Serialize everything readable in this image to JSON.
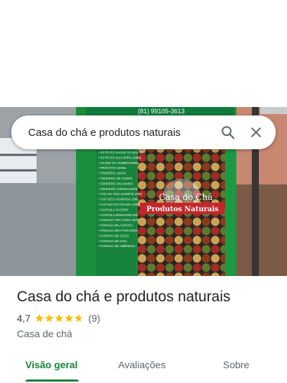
{
  "search": {
    "query": "Casa do chá e produtos naturais"
  },
  "photo": {
    "banner_phone": "(81) 99105-3613",
    "sign_name": "Casa do Chá",
    "sign_sub": "Produtos Naturais",
    "window_list": [
      "EXTRATO SAÚDE DA MULHER",
      "EXTRATO SUCUPIRA 100ML",
      "SAÚDE DO HOMEM 500ML",
      "PRÓSTATA 500ML",
      "TEMPERO LIMÃO",
      "TEMPERO DE OVERS",
      "TEMPERO ANA MARIA",
      "TEMPERO CHIMICHURRI",
      "CHÁ DA VIDA DIABETE 100G",
      "CHÁ SECA BARRIGA 100G",
      "CHÁ DETOX FIGADO 100G",
      "CÁPSULA VIAGRIN",
      "CÁPSULA REMAGRECER",
      "POMADA TIRA COM A MÃO",
      "POMADA MILAGROSA",
      "POMADA DRA-POR-NÓIS",
      "FARINHA DE COCO",
      "FARINHA DE CHIA",
      "FARINHA DE AMÊNDOA..."
    ]
  },
  "place": {
    "name": "Casa do chá e produtos naturais",
    "rating": "4,7",
    "rating_fraction": 0.94,
    "review_count": "(9)",
    "category": "Casa de chá"
  },
  "tabs": [
    {
      "label": "Visão geral",
      "active": true
    },
    {
      "label": "Avaliações",
      "active": false
    },
    {
      "label": "Sobre",
      "active": false
    }
  ],
  "colors": {
    "accent": "#188038",
    "star": "#fbbc04",
    "star_empty": "#dadce0"
  },
  "icons": {
    "search": "search-icon",
    "close": "close-icon",
    "star": "star-icon"
  }
}
